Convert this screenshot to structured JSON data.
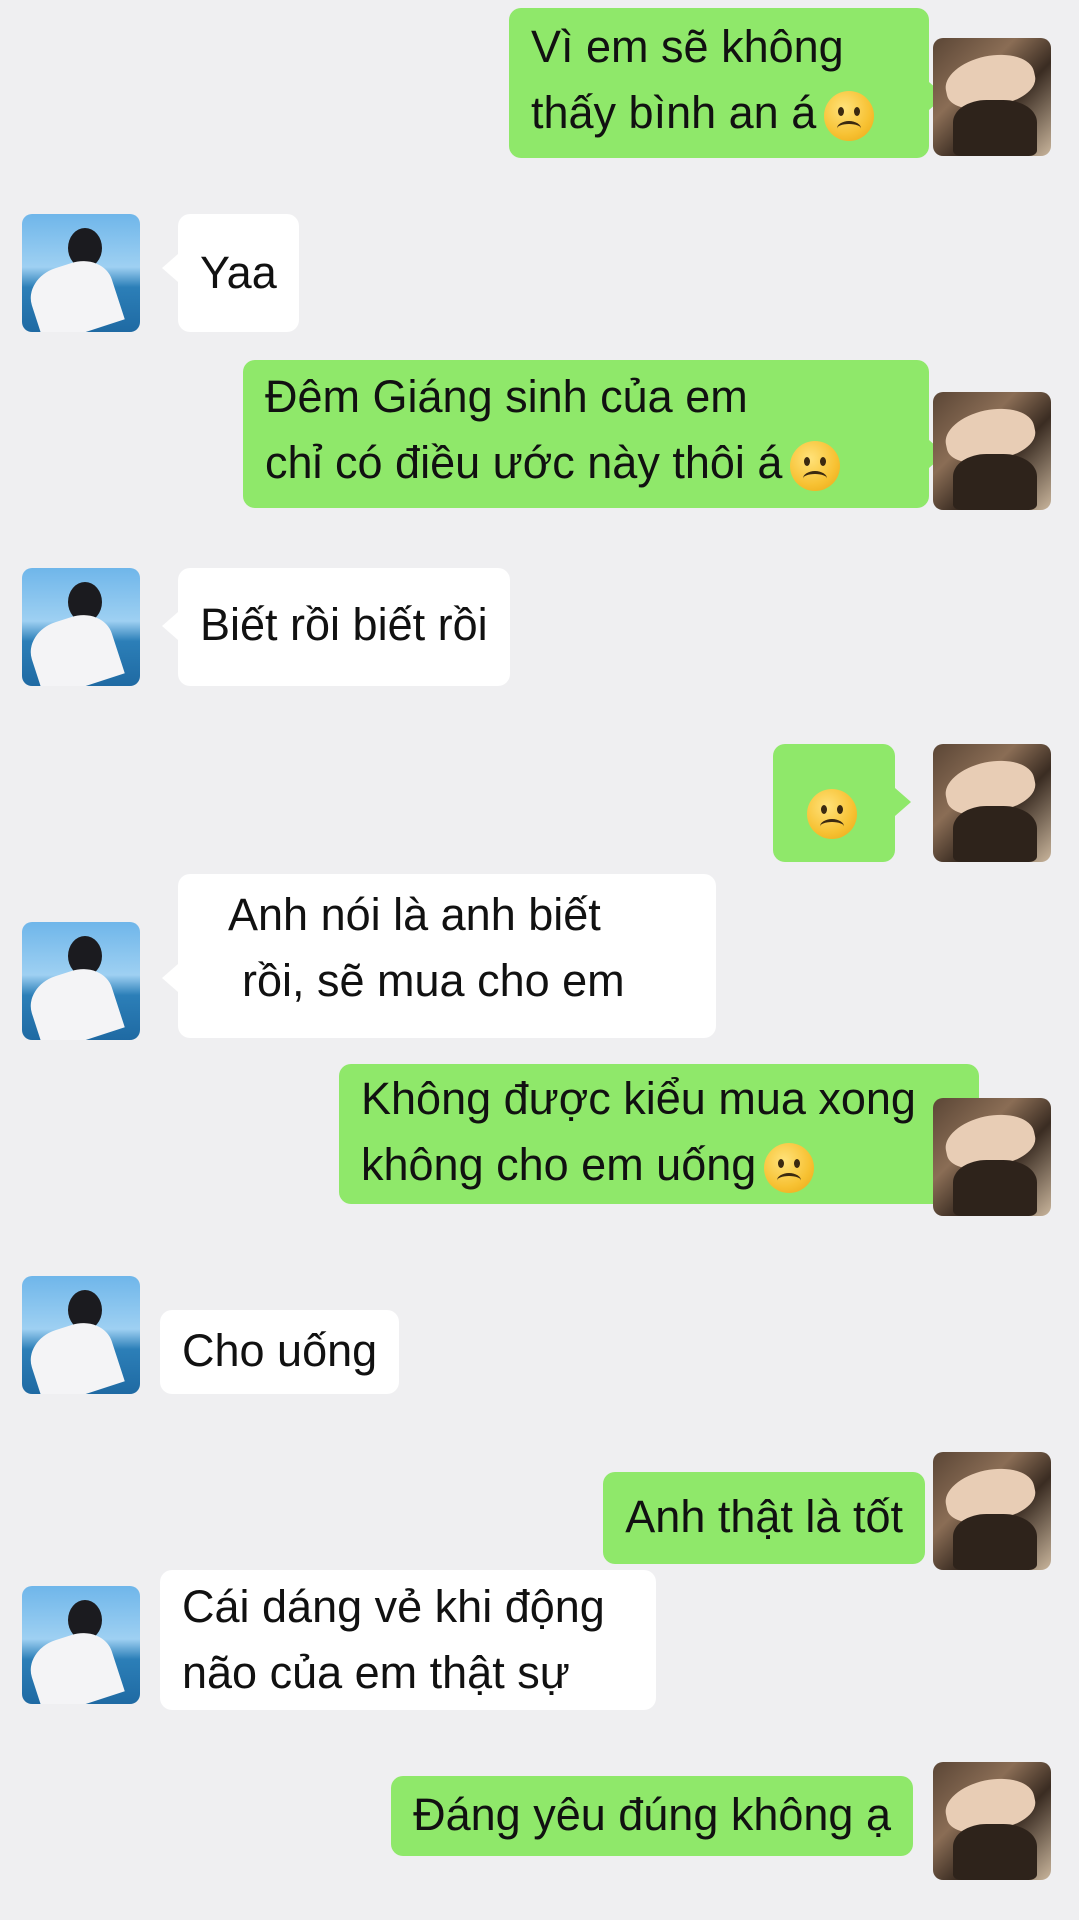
{
  "messages": [
    {
      "from": "me",
      "lines": [
        "Vì em sẽ không",
        "thấy bình an á"
      ],
      "emoji": "frowning-face"
    },
    {
      "from": "other",
      "lines": [
        "Yaa"
      ]
    },
    {
      "from": "me",
      "lines": [
        "Đêm Giáng sinh của em",
        "chỉ có điều ước này thôi á"
      ],
      "emoji": "frowning-face"
    },
    {
      "from": "other",
      "lines": [
        "Biết rồi biết rồi"
      ]
    },
    {
      "from": "me",
      "lines": [],
      "emoji": "frowning-face"
    },
    {
      "from": "other",
      "lines": [
        "Anh nói là anh biết",
        "rồi, sẽ mua cho em"
      ]
    },
    {
      "from": "me",
      "lines": [
        "Không được kiểu mua xong",
        "không cho em uống"
      ],
      "emoji": "frowning-face"
    },
    {
      "from": "other",
      "lines": [
        "Cho uống"
      ]
    },
    {
      "from": "me",
      "lines": [
        "Anh thật là tốt"
      ]
    },
    {
      "from": "other",
      "lines": [
        "Cái dáng vẻ khi động",
        "não của em thật sự"
      ]
    },
    {
      "from": "me",
      "lines": [
        "Đáng yêu đúng không ạ"
      ]
    }
  ],
  "colors": {
    "background": "#efeff1",
    "my_bubble": "#8fe86a",
    "other_bubble": "#ffffff"
  }
}
